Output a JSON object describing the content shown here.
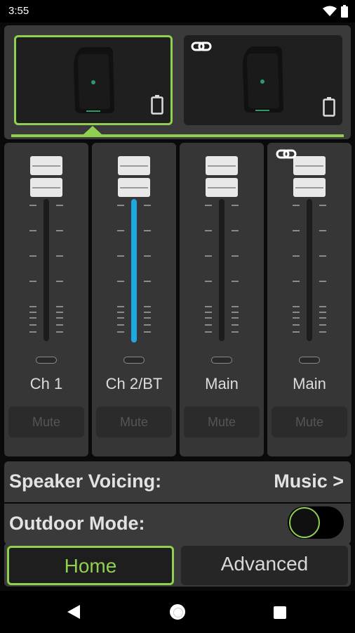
{
  "status_bar": {
    "time": "3:55",
    "icons": [
      "wifi-icon",
      "battery-icon"
    ]
  },
  "speakers": [
    {
      "name": "speaker-1",
      "selected": true,
      "linked": false
    },
    {
      "name": "speaker-2",
      "selected": false,
      "linked": true
    }
  ],
  "channels": [
    {
      "label": "Ch 1",
      "mute_label": "Mute",
      "level": 0,
      "linked": false
    },
    {
      "label": "Ch 2/BT",
      "mute_label": "Mute",
      "level": 1,
      "linked": false
    },
    {
      "label": "Main",
      "mute_label": "Mute",
      "level": 0,
      "linked": false
    },
    {
      "label": "Main",
      "mute_label": "Mute",
      "level": 0,
      "linked": true
    }
  ],
  "settings": {
    "voicing_label": "Speaker Voicing:",
    "voicing_value": "Music >",
    "outdoor_label": "Outdoor Mode:",
    "outdoor_on": false
  },
  "tabs": [
    {
      "label": "Home",
      "active": true
    },
    {
      "label": "Advanced",
      "active": false
    }
  ],
  "colors": {
    "accent": "#8fd14f",
    "fader_fill": "#1ea7e0",
    "panel": "#3a3a3a"
  }
}
